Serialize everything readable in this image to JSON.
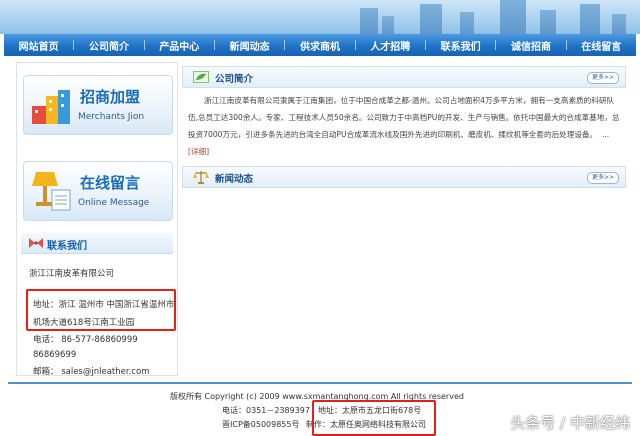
{
  "nav": [
    "网站首页",
    "公司简介",
    "产品中心",
    "新闻动态",
    "供求商机",
    "人才招聘",
    "联系我们",
    "诚信招商",
    "在线留言"
  ],
  "promo_merchants": {
    "title": "招商加盟",
    "subtitle": "Merchants Jion"
  },
  "promo_message": {
    "title": "在线留言",
    "subtitle": "Online Message"
  },
  "contact": {
    "heading": "联系我们",
    "company": "浙江江南皮革有限公司",
    "address_line1": "地址：浙江 温州市 中国浙江省温州市",
    "address_line2": "机场大道618号江南工业园",
    "phone_line1": "电话： 86-577-86860999",
    "phone_line2": "86869699",
    "email": "邮箱： sales@jnleather.com"
  },
  "about": {
    "title": "公司简介",
    "more": "更多>>",
    "lines": [
      "浙江江南皮革有限公司隶属于江南集团，位于中国合成革之都-温州。公司占地面积4万多平方米，拥有一支高素质",
      "的科研队伍,总员工达300余人。专家、工程技术人员50余名。公司致力于中高档PU的开发、生产与销售。依托中国最",
      "大的合成革基地，总投资7000万元，引进多条先进的台湾全自动PU合成革流水线及国外先进的印刷机、磨皮机、揉纹",
      "机等全套的后处理设备。"
    ],
    "ellipsis": "...",
    "detail": "[详细]"
  },
  "news": {
    "title": "新闻动态",
    "more": "更多>>"
  },
  "footer": {
    "copyright": "版权所有 Copyright (c) 2009 www.sxmantanghong.com All rights reserved",
    "phone": "电话：0351－2389397",
    "address": "地址：太原市五龙口街678号",
    "icp": "晋ICP备05009855号",
    "maker": "制作：太原任奥网络科技有限公司"
  },
  "watermark": "头条号 / 中新经纬",
  "colors": {
    "nav": "#1f73c7",
    "highlight": "#e3201b",
    "link": "#1a5fa8"
  }
}
